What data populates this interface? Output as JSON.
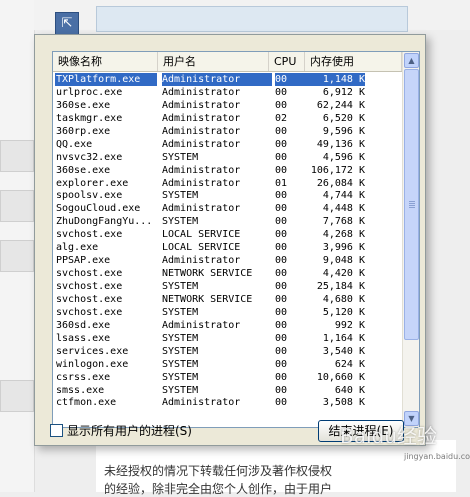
{
  "background": {
    "icon": "window-icon",
    "text_lines": [
      "未经授权的情况下转载任何涉及著作权侵权",
      "的经验，除非完全由您个人创作，由于用户"
    ]
  },
  "dialog": {
    "columns": {
      "image_name": "映像名称",
      "user_name": "用户名",
      "cpu": "CPU",
      "memory": "内存使用"
    },
    "processes": [
      {
        "name": "TXPlatform.exe",
        "user": "Administrator",
        "cpu": "00",
        "mem": "1,148 K",
        "selected": true
      },
      {
        "name": "urlproc.exe",
        "user": "Administrator",
        "cpu": "00",
        "mem": "6,912 K"
      },
      {
        "name": "360se.exe",
        "user": "Administrator",
        "cpu": "00",
        "mem": "62,244 K"
      },
      {
        "name": "taskmgr.exe",
        "user": "Administrator",
        "cpu": "02",
        "mem": "6,520 K"
      },
      {
        "name": "360rp.exe",
        "user": "Administrator",
        "cpu": "00",
        "mem": "9,596 K"
      },
      {
        "name": "QQ.exe",
        "user": "Administrator",
        "cpu": "00",
        "mem": "49,136 K"
      },
      {
        "name": "nvsvc32.exe",
        "user": "SYSTEM",
        "cpu": "00",
        "mem": "4,596 K"
      },
      {
        "name": "360se.exe",
        "user": "Administrator",
        "cpu": "00",
        "mem": "106,172 K"
      },
      {
        "name": "explorer.exe",
        "user": "Administrator",
        "cpu": "01",
        "mem": "26,084 K"
      },
      {
        "name": "spoolsv.exe",
        "user": "SYSTEM",
        "cpu": "00",
        "mem": "4,744 K"
      },
      {
        "name": "SogouCloud.exe",
        "user": "Administrator",
        "cpu": "00",
        "mem": "4,448 K"
      },
      {
        "name": "ZhuDongFangYu...",
        "user": "SYSTEM",
        "cpu": "00",
        "mem": "7,768 K"
      },
      {
        "name": "svchost.exe",
        "user": "LOCAL SERVICE",
        "cpu": "00",
        "mem": "4,268 K"
      },
      {
        "name": "alg.exe",
        "user": "LOCAL SERVICE",
        "cpu": "00",
        "mem": "3,996 K"
      },
      {
        "name": "PPSAP.exe",
        "user": "Administrator",
        "cpu": "00",
        "mem": "9,048 K"
      },
      {
        "name": "svchost.exe",
        "user": "NETWORK SERVICE",
        "cpu": "00",
        "mem": "4,420 K"
      },
      {
        "name": "svchost.exe",
        "user": "SYSTEM",
        "cpu": "00",
        "mem": "25,184 K"
      },
      {
        "name": "svchost.exe",
        "user": "NETWORK SERVICE",
        "cpu": "00",
        "mem": "4,680 K"
      },
      {
        "name": "svchost.exe",
        "user": "SYSTEM",
        "cpu": "00",
        "mem": "5,120 K"
      },
      {
        "name": "360sd.exe",
        "user": "Administrator",
        "cpu": "00",
        "mem": "992 K"
      },
      {
        "name": "lsass.exe",
        "user": "SYSTEM",
        "cpu": "00",
        "mem": "1,164 K"
      },
      {
        "name": "services.exe",
        "user": "SYSTEM",
        "cpu": "00",
        "mem": "3,540 K"
      },
      {
        "name": "winlogon.exe",
        "user": "SYSTEM",
        "cpu": "00",
        "mem": "624 K"
      },
      {
        "name": "csrss.exe",
        "user": "SYSTEM",
        "cpu": "00",
        "mem": "10,660 K"
      },
      {
        "name": "smss.exe",
        "user": "SYSTEM",
        "cpu": "00",
        "mem": "640 K"
      },
      {
        "name": "ctfmon.exe",
        "user": "Administrator",
        "cpu": "00",
        "mem": "3,508 K"
      }
    ],
    "show_all_label": "显示所有用户的进程(S)",
    "show_all_checked": false,
    "end_process_label": "结束进程(E)"
  },
  "watermark": "Baidu经验",
  "watermark_sub": "jingyan.baidu.com"
}
